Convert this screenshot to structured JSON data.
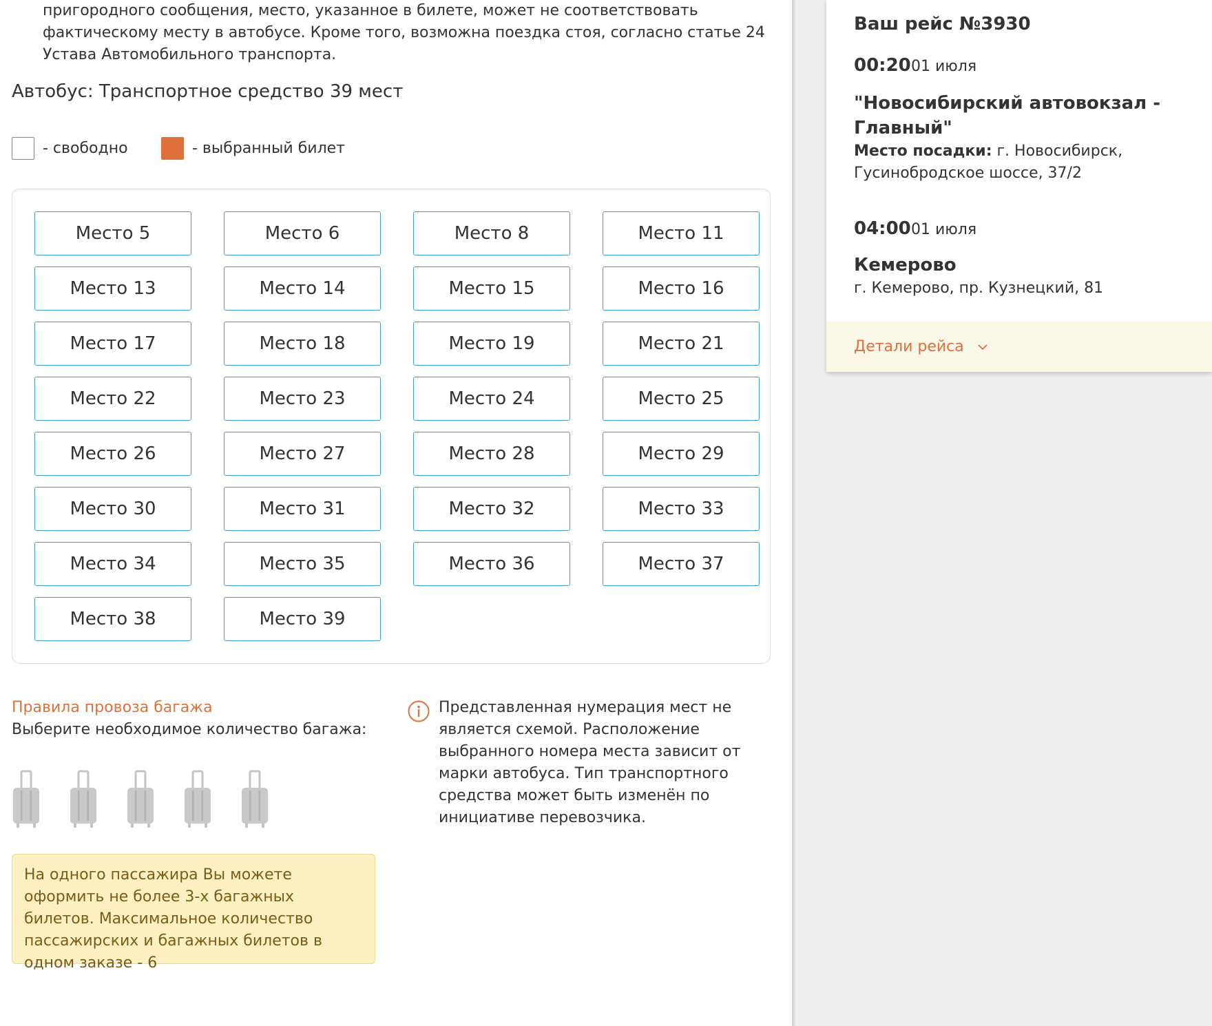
{
  "notice": {
    "text": "пригородного сообщения, место, указанное в билете, может не соответствовать фактическому месту в автобусе. Кроме того, возможна поездка стоя, согласно статье 24 Устава Автомобильного транспорта."
  },
  "bus": {
    "title": "Автобус: Транспортное средство 39 мест"
  },
  "legend": {
    "free_label": "- свободно",
    "selected_label": "- выбранный билет",
    "free_color": "#3a9bd6",
    "selected_color": "#e0703a"
  },
  "seats": [
    "Место 5",
    "Место 6",
    "Место 8",
    "Место 11",
    "Место 13",
    "Место 14",
    "Место 15",
    "Место 16",
    "Место 17",
    "Место 18",
    "Место 19",
    "Место 21",
    "Место 22",
    "Место 23",
    "Место 24",
    "Место 25",
    "Место 26",
    "Место 27",
    "Место 28",
    "Место 29",
    "Место 30",
    "Место 31",
    "Место 32",
    "Место 33",
    "Место 34",
    "Место 35",
    "Место 36",
    "Место 37",
    "Место 38",
    "Место 39"
  ],
  "baggage": {
    "rules_link": "Правила провоза багажа",
    "prompt": "Выберите необходимое количество багажа:",
    "suitcase_icon": "suitcase-icon",
    "suitcase_count": 5,
    "note": "На одного пассажира Вы можете оформить не более 3-х багажных билетов. Максимальное количество пассажирских и багажных билетов в одном заказе - 6"
  },
  "info": {
    "icon": "info-icon",
    "text": "Представленная нумерация мест не является схемой. Расположение выбранного номера места зависит от марки автобуса. Тип транспортного средства может быть изменён по инициативе перевозчика."
  },
  "trip": {
    "title": "Ваш рейс №3930",
    "departure": {
      "time": "00:20",
      "date": "01 июля",
      "station": "\"Новосибирский автовокзал - Главный\"",
      "boarding_label": "Место посадки:",
      "boarding_address": "г. Новосибирск, Гусинобродское шоссе, 37/2"
    },
    "arrival": {
      "time": "04:00",
      "date": "01 июля",
      "city": "Кемерово",
      "address": "г. Кемерово, пр. Кузнецкий, 81"
    },
    "details_link": "Детали рейса",
    "accent_color": "#e0703a"
  }
}
